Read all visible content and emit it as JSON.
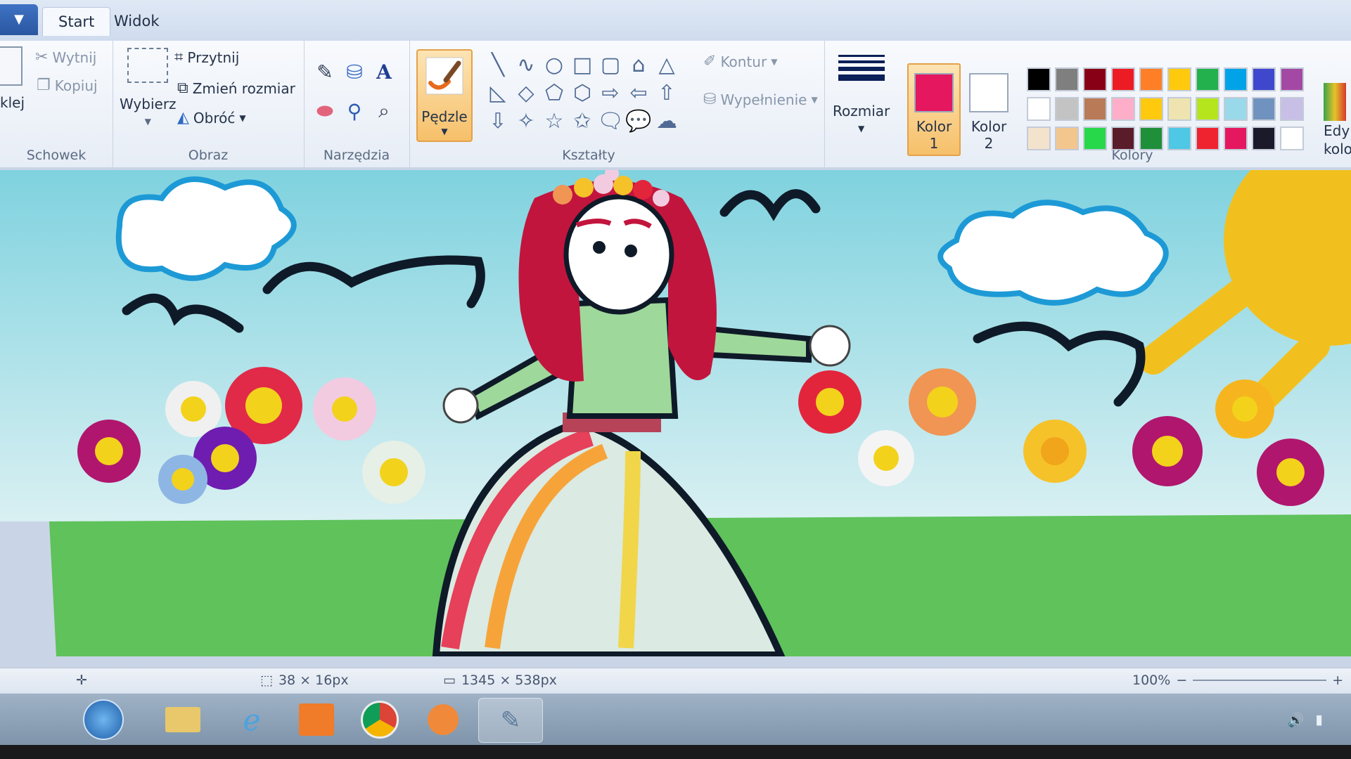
{
  "tabs": {
    "app_menu_icon": "chevron-down-icon",
    "items": [
      {
        "label": "Start",
        "active": true
      },
      {
        "label": "Widok",
        "active": false
      }
    ]
  },
  "ribbon": {
    "clipboard": {
      "label": "Schowek",
      "paste_label": "klej",
      "cut_label": "Wytnij",
      "copy_label": "Kopiuj"
    },
    "image": {
      "label": "Obraz",
      "select_label": "Wybierz",
      "crop_label": "Przytnij",
      "resize_label": "Zmień rozmiar",
      "rotate_label": "Obróć"
    },
    "tools": {
      "label": "Narzędzia",
      "items": [
        "pencil-icon",
        "fill-icon",
        "text-icon",
        "eraser-icon",
        "color-picker-icon",
        "magnifier-icon"
      ]
    },
    "brushes": {
      "label": "Pędzle"
    },
    "shapes": {
      "label": "Kształty",
      "outline_label": "Kontur",
      "fill_label": "Wypełnienie",
      "symbols": [
        "╲",
        "∿",
        "○",
        "□",
        "▢",
        "⌂",
        "△",
        "◺",
        "◇",
        "⬠",
        "⬡",
        "⇨",
        "⇦",
        "⇧",
        "⇩",
        "✧",
        "☆",
        "✩",
        "🗨",
        "💬",
        "☁"
      ]
    },
    "size": {
      "label": "Rozmiar"
    },
    "color1": {
      "label": "Kolor",
      "num": "1",
      "value": "#e5175f"
    },
    "color2": {
      "label": "Kolor",
      "num": "2",
      "value": "#ffffff"
    },
    "colors": {
      "label": "Kolory",
      "edit_label": "Edy",
      "edit_label2": "kolo",
      "palette": [
        "#000000",
        "#7f7f7f",
        "#880015",
        "#ed1c24",
        "#ff7f27",
        "#ffc90e",
        "#22b14c",
        "#00a2e8",
        "#3f48cc",
        "#a349a4",
        "#ffffff",
        "#c3c3c3",
        "#b97a57",
        "#ffaec9",
        "#ffc90e",
        "#efe4b0",
        "#b5e61d",
        "#99d9ea",
        "#7092be",
        "#c8bfe7",
        "#f3e3cc",
        "#f3c68e",
        "#27d84a",
        "#5a1c2a",
        "#1f8f3a",
        "#4ec8e4",
        "#ef2230",
        "#e5175f",
        "#1a1a2a",
        "#ffffff"
      ]
    }
  },
  "status": {
    "selection": "38 × 16px",
    "canvas_size": "1345 × 538px",
    "zoom": "100%"
  },
  "taskbar": {
    "items": [
      "start-orb-icon",
      "explorer-icon",
      "ie-icon",
      "store-icon",
      "chrome-icon",
      "media-player-icon",
      "paint-icon"
    ]
  }
}
